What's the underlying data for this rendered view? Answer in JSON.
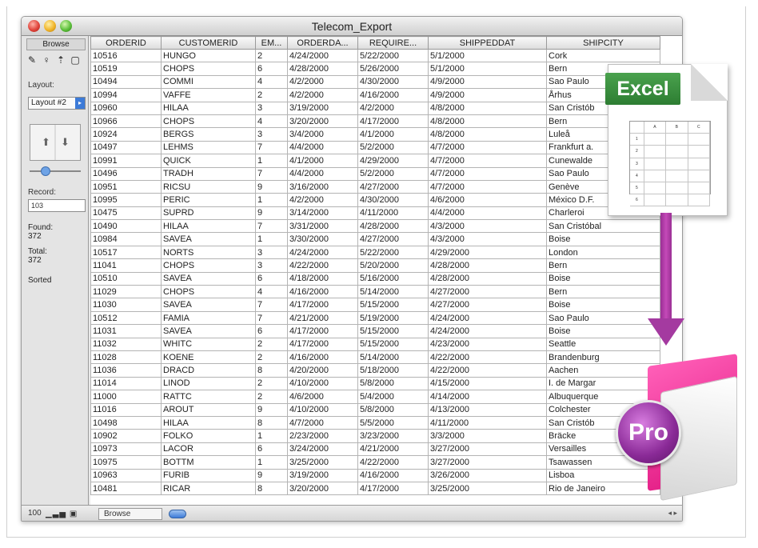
{
  "window": {
    "title": "Telecom_Export"
  },
  "sidebar": {
    "mode_label": "Browse",
    "tools": [
      "✎",
      "♀",
      "⇡",
      "▢"
    ],
    "layout_label": "Layout:",
    "layout_value": "Layout #2",
    "book_arrows": [
      "⬆",
      "⬇"
    ],
    "record_label": "Record:",
    "record_value": "103",
    "found_label": "Found:",
    "found_value": "372",
    "total_label": "Total:",
    "total_value": "372",
    "sorted_label": "Sorted"
  },
  "table": {
    "columns": [
      "ORDERID",
      "CUSTOMERID",
      "EM...",
      "ORDERDA...",
      "REQUIRE...",
      "SHIPPEDDAT",
      "SHIPCITY"
    ],
    "rows": [
      [
        "10516",
        "HUNGO",
        "2",
        "4/24/2000",
        "5/22/2000",
        "5/1/2000",
        "Cork"
      ],
      [
        "10519",
        "CHOPS",
        "6",
        "4/28/2000",
        "5/26/2000",
        "5/1/2000",
        "Bern"
      ],
      [
        "10494",
        "COMMI",
        "4",
        "4/2/2000",
        "4/30/2000",
        "4/9/2000",
        "Sao Paulo"
      ],
      [
        "10994",
        "VAFFE",
        "2",
        "4/2/2000",
        "4/16/2000",
        "4/9/2000",
        "Århus"
      ],
      [
        "10960",
        "HILAA",
        "3",
        "3/19/2000",
        "4/2/2000",
        "4/8/2000",
        "San Cristób"
      ],
      [
        "10966",
        "CHOPS",
        "4",
        "3/20/2000",
        "4/17/2000",
        "4/8/2000",
        "Bern"
      ],
      [
        "10924",
        "BERGS",
        "3",
        "3/4/2000",
        "4/1/2000",
        "4/8/2000",
        "Luleå"
      ],
      [
        "10497",
        "LEHMS",
        "7",
        "4/4/2000",
        "5/2/2000",
        "4/7/2000",
        "Frankfurt a."
      ],
      [
        "10991",
        "QUICK",
        "1",
        "4/1/2000",
        "4/29/2000",
        "4/7/2000",
        "Cunewalde"
      ],
      [
        "10496",
        "TRADH",
        "7",
        "4/4/2000",
        "5/2/2000",
        "4/7/2000",
        "Sao Paulo"
      ],
      [
        "10951",
        "RICSU",
        "9",
        "3/16/2000",
        "4/27/2000",
        "4/7/2000",
        "Genève"
      ],
      [
        "10995",
        "PERIC",
        "1",
        "4/2/2000",
        "4/30/2000",
        "4/6/2000",
        "México D.F."
      ],
      [
        "10475",
        "SUPRD",
        "9",
        "3/14/2000",
        "4/11/2000",
        "4/4/2000",
        "Charleroi"
      ],
      [
        "10490",
        "HILAA",
        "7",
        "3/31/2000",
        "4/28/2000",
        "4/3/2000",
        "San Cristóbal"
      ],
      [
        "10984",
        "SAVEA",
        "1",
        "3/30/2000",
        "4/27/2000",
        "4/3/2000",
        "Boise"
      ],
      [
        "10517",
        "NORTS",
        "3",
        "4/24/2000",
        "5/22/2000",
        "4/29/2000",
        "London"
      ],
      [
        "11041",
        "CHOPS",
        "3",
        "4/22/2000",
        "5/20/2000",
        "4/28/2000",
        "Bern"
      ],
      [
        "10510",
        "SAVEA",
        "6",
        "4/18/2000",
        "5/16/2000",
        "4/28/2000",
        "Boise"
      ],
      [
        "11029",
        "CHOPS",
        "4",
        "4/16/2000",
        "5/14/2000",
        "4/27/2000",
        "Bern"
      ],
      [
        "11030",
        "SAVEA",
        "7",
        "4/17/2000",
        "5/15/2000",
        "4/27/2000",
        "Boise"
      ],
      [
        "10512",
        "FAMIA",
        "7",
        "4/21/2000",
        "5/19/2000",
        "4/24/2000",
        "Sao Paulo"
      ],
      [
        "11031",
        "SAVEA",
        "6",
        "4/17/2000",
        "5/15/2000",
        "4/24/2000",
        "Boise"
      ],
      [
        "11032",
        "WHITC",
        "2",
        "4/17/2000",
        "5/15/2000",
        "4/23/2000",
        "Seattle"
      ],
      [
        "11028",
        "KOENE",
        "2",
        "4/16/2000",
        "5/14/2000",
        "4/22/2000",
        "Brandenburg"
      ],
      [
        "11036",
        "DRACD",
        "8",
        "4/20/2000",
        "5/18/2000",
        "4/22/2000",
        "Aachen"
      ],
      [
        "11014",
        "LINOD",
        "2",
        "4/10/2000",
        "5/8/2000",
        "4/15/2000",
        "I. de Margar"
      ],
      [
        "11000",
        "RATTC",
        "2",
        "4/6/2000",
        "5/4/2000",
        "4/14/2000",
        "Albuquerque"
      ],
      [
        "11016",
        "AROUT",
        "9",
        "4/10/2000",
        "5/8/2000",
        "4/13/2000",
        "Colchester"
      ],
      [
        "10498",
        "HILAA",
        "8",
        "4/7/2000",
        "5/5/2000",
        "4/11/2000",
        "San Cristób"
      ],
      [
        "10902",
        "FOLKO",
        "1",
        "2/23/2000",
        "3/23/2000",
        "3/3/2000",
        "Bräcke"
      ],
      [
        "10973",
        "LACOR",
        "6",
        "3/24/2000",
        "4/21/2000",
        "3/27/2000",
        "Versailles"
      ],
      [
        "10975",
        "BOTTM",
        "1",
        "3/25/2000",
        "4/22/2000",
        "3/27/2000",
        "Tsawassen"
      ],
      [
        "10963",
        "FURIB",
        "9",
        "3/19/2000",
        "4/16/2000",
        "3/26/2000",
        "Lisboa"
      ],
      [
        "10481",
        "RICAR",
        "8",
        "3/20/2000",
        "4/17/2000",
        "3/25/2000",
        "Rio de Janeiro"
      ]
    ]
  },
  "bottombar": {
    "zoom": "100",
    "mode": "Browse",
    "h_arrows": "◂ ▸"
  },
  "overlay": {
    "excel_label": "Excel",
    "excel_cols": [
      "",
      "A",
      "B",
      "C"
    ],
    "excel_rows": [
      "1",
      "2",
      "3",
      "4",
      "5",
      "6"
    ],
    "pro_label": "Pro"
  },
  "colors": {
    "excel_green": "#2d7d32",
    "arrow_purple": "#a43aa0",
    "pro_pink": "#e0157f",
    "pro_purple": "#8a2a97"
  }
}
